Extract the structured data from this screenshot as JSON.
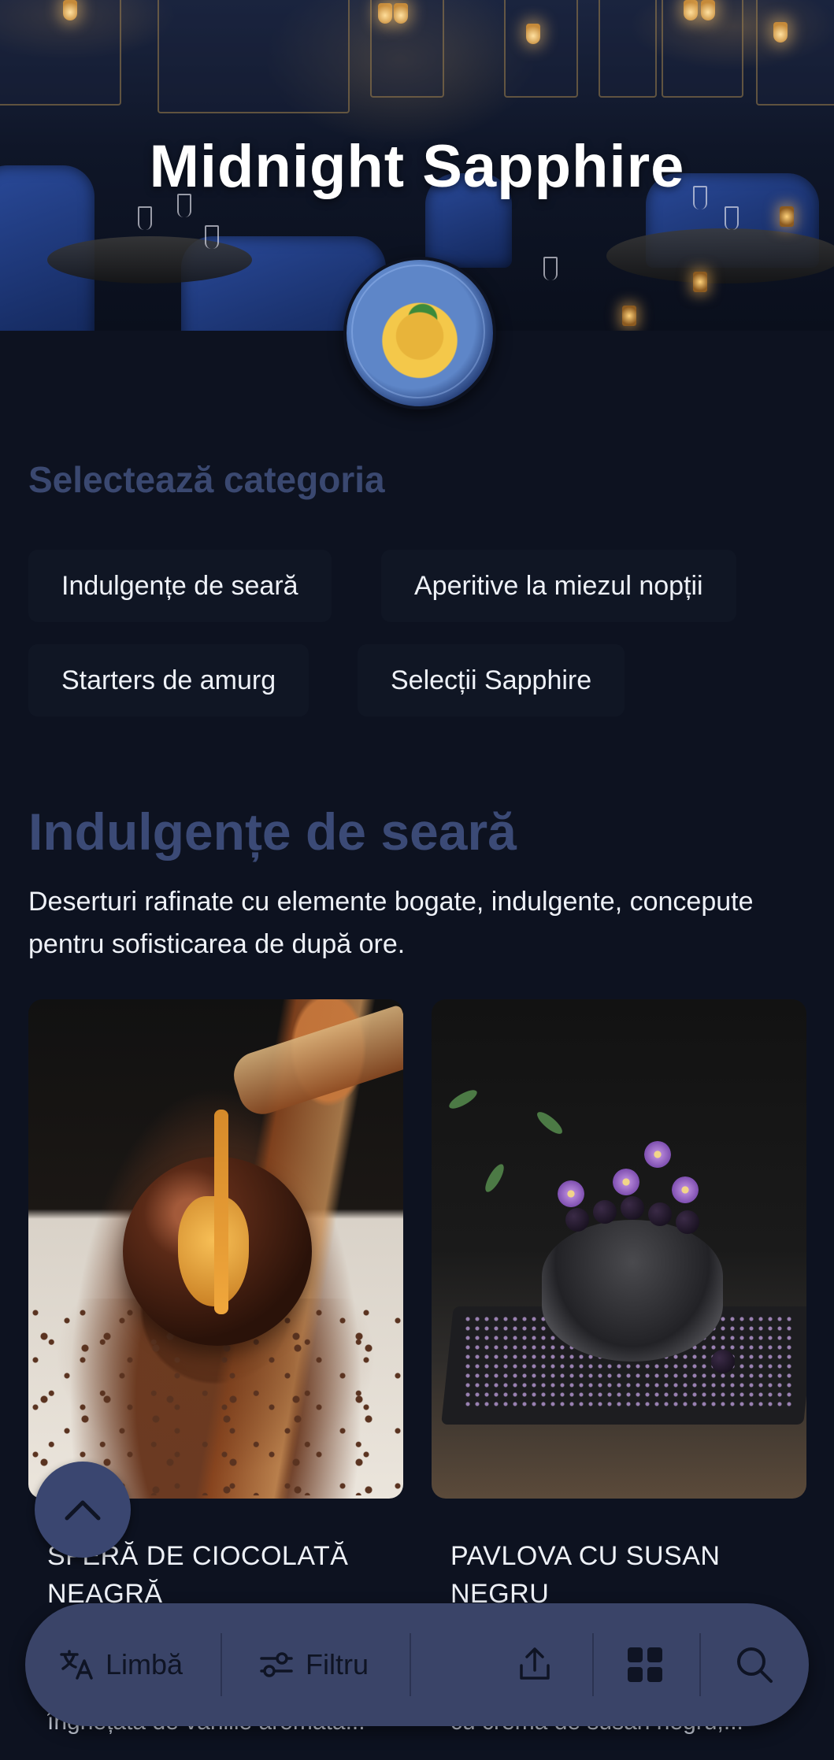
{
  "header": {
    "title": "Midnight Sapphire"
  },
  "categories_section": {
    "label": "Selectează categoria",
    "chips": [
      "Indulgențe de seară",
      "Aperitive la miezul nopții",
      "Starters de amurg",
      "Selecții Sapphire"
    ]
  },
  "category": {
    "title": "Indulgențe de seară",
    "description": "Deserturi rafinate cu elemente bogate, indulgente, concepute pentru sofisticarea de după ore."
  },
  "products": [
    {
      "name": "SFERĂ DE CIOCOLATĂ NEAGRĂ",
      "subtitle": "înghețată de vanilie aromată..."
    },
    {
      "name": "PAVLOVA CU SUSAN NEGRU",
      "subtitle": "cu cremă de susan negru,..."
    }
  ],
  "bottom_bar": {
    "language_label": "Limbă",
    "filter_label": "Filtru",
    "icons": [
      "translate-icon",
      "filter-icon",
      "share-icon",
      "grid-icon",
      "search-icon"
    ]
  },
  "colors": {
    "background": "#0d1220",
    "accent": "#3b4a76",
    "bar": "#3a4468"
  }
}
